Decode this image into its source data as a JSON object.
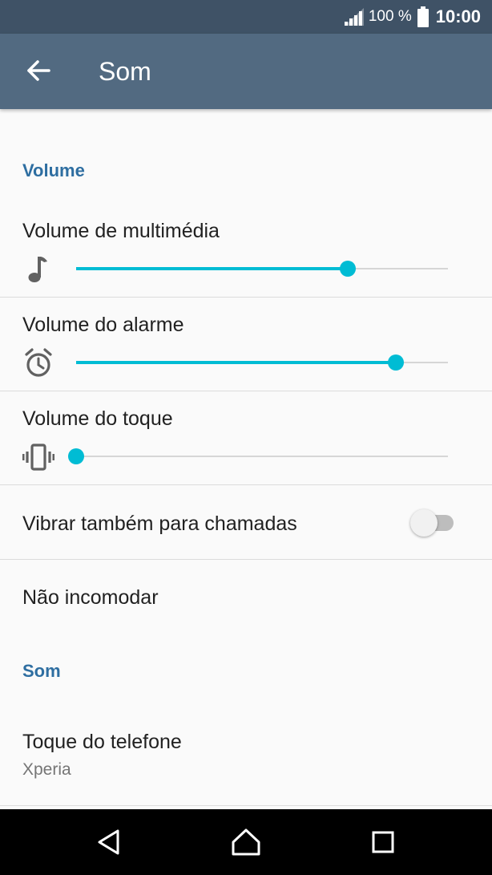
{
  "status_bar": {
    "battery_percent": "100 %",
    "time": "10:00",
    "signal_icon": "cell-signal-icon",
    "battery_icon": "battery-full-icon"
  },
  "app_bar": {
    "title": "Som",
    "back_icon": "arrow-back-icon"
  },
  "sections": {
    "volume_header": "Volume",
    "sound_header": "Som"
  },
  "volume": {
    "media": {
      "label": "Volume de multimédia",
      "icon": "music-note-icon",
      "level": 0.73
    },
    "alarm": {
      "label": "Volume do alarme",
      "icon": "alarm-clock-icon",
      "level": 0.86
    },
    "ringer": {
      "label": "Volume do toque",
      "icon": "vibrate-icon",
      "level": 0.0
    }
  },
  "settings": {
    "vibrate_calls": {
      "label": "Vibrar também para chamadas",
      "enabled": false
    },
    "do_not_disturb": {
      "label": "Não incomodar"
    },
    "ringtone": {
      "label": "Toque do telefone",
      "value": "Xperia"
    }
  },
  "nav_bar": {
    "back_icon": "nav-back-icon",
    "home_icon": "nav-home-icon",
    "recents_icon": "nav-recents-icon"
  },
  "colors": {
    "status_bar": "#3f5266",
    "app_bar": "#526a81",
    "accent": "#00bcd4",
    "section_header": "#2e6ea1"
  }
}
